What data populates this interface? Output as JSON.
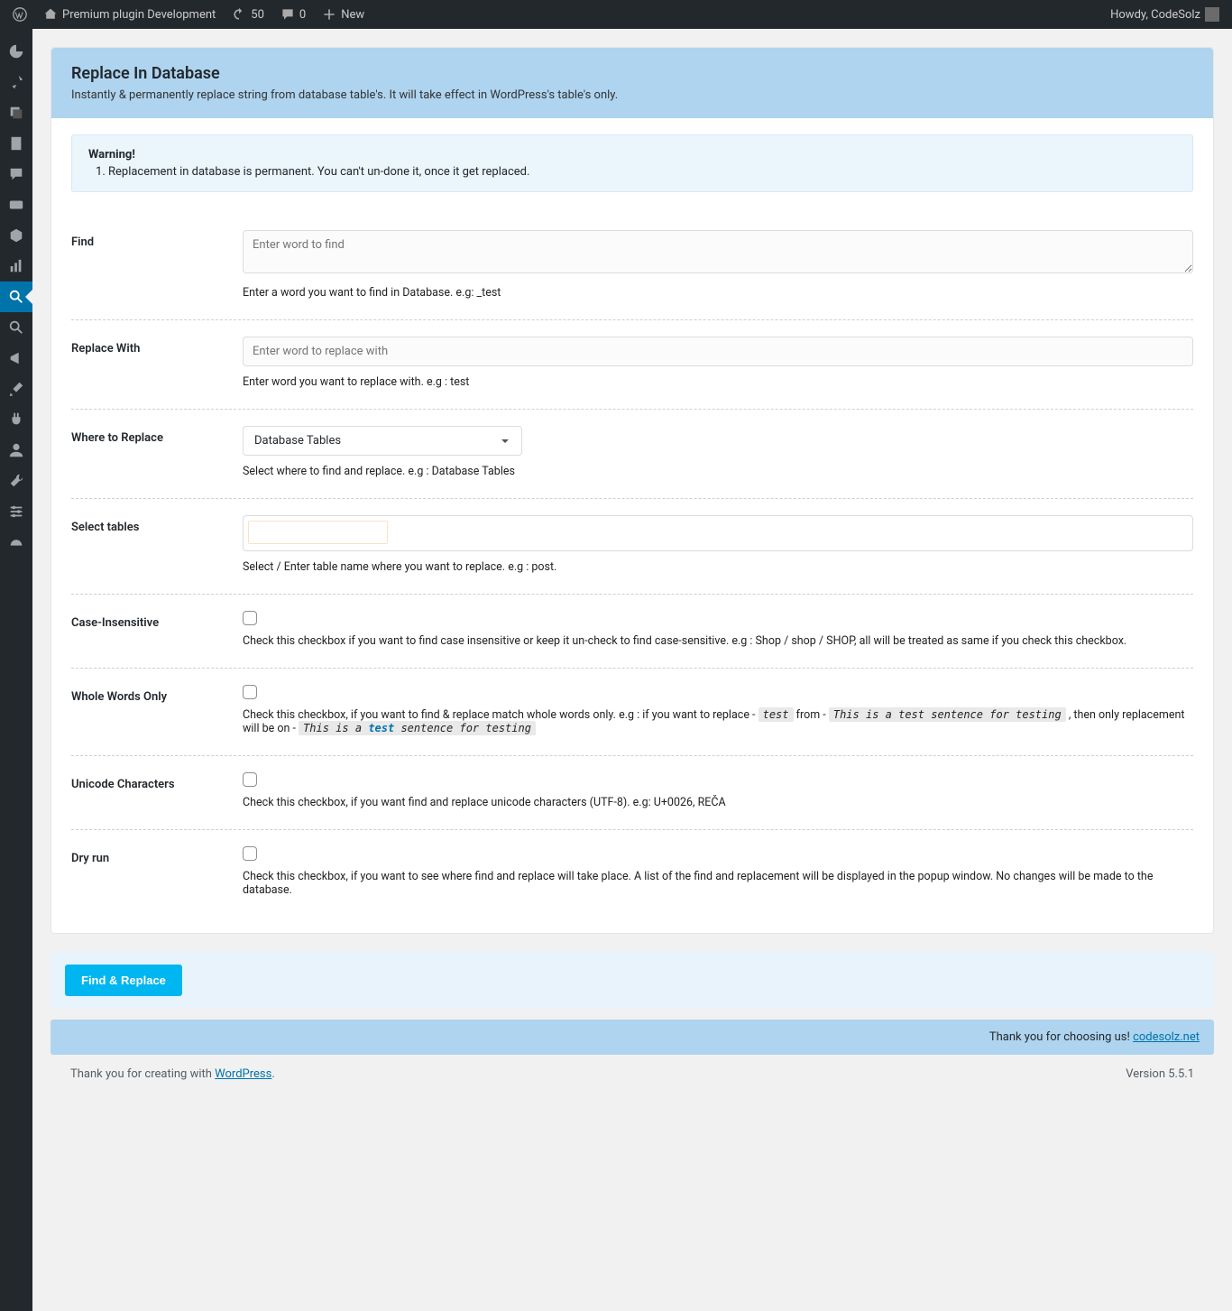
{
  "adminbar": {
    "site_name": "Premium plugin Development",
    "updates": "50",
    "comments": "0",
    "new": "New",
    "howdy": "Howdy, CodeSolz"
  },
  "card": {
    "title": "Replace In Database",
    "subtitle": "Instantly & permanently replace string from database table's. It will take effect in WordPress's table's only."
  },
  "warning": {
    "title": "Warning!",
    "text": "Replacement in database is permanent. You can't un-done it, once it get replaced."
  },
  "fields": {
    "find": {
      "label": "Find",
      "placeholder": "Enter word to find",
      "help": "Enter a word you want to find in Database. e.g: _test"
    },
    "replace": {
      "label": "Replace With",
      "placeholder": "Enter word to replace with",
      "help": "Enter word you want to replace with. e.g : test"
    },
    "where": {
      "label": "Where to Replace",
      "selected": "Database Tables",
      "help": "Select where to find and replace. e.g : Database Tables"
    },
    "tables": {
      "label": "Select tables",
      "help": "Select / Enter table name where you want to replace. e.g : post."
    },
    "case": {
      "label": "Case-Insensitive",
      "help": "Check this checkbox if you want to find case insensitive or keep it un-check to find case-sensitive. e.g : Shop / shop / SHOP, all will be treated as same if you check this checkbox."
    },
    "whole": {
      "label": "Whole Words Only",
      "help_pre": "Check this checkbox, if you want to find & replace match whole words only. e.g : if you want to replace - ",
      "chip1": "test",
      "help_mid1": "  from - ",
      "chip2_a": "This is a test sentence for testing",
      "help_mid2": " , then only replacement will be on - ",
      "chip3_pre": "This is a ",
      "chip3_mid": "test",
      "chip3_post": " sentence for testing"
    },
    "unicode": {
      "label": "Unicode Characters",
      "help": "Check this checkbox, if you want find and replace unicode characters (UTF-8). e.g: U+0026, REČA"
    },
    "dry": {
      "label": "Dry run",
      "help": "Check this checkbox, if you want to see where find and replace will take place. A list of the find and replacement will be displayed in the popup window. No changes will be made to the database."
    }
  },
  "submit_label": "Find & Replace",
  "thanks": {
    "text": "Thank you for choosing us! ",
    "link": "codesolz.net"
  },
  "footer": {
    "text": "Thank you for creating with ",
    "link": "WordPress",
    "version": "Version 5.5.1"
  }
}
